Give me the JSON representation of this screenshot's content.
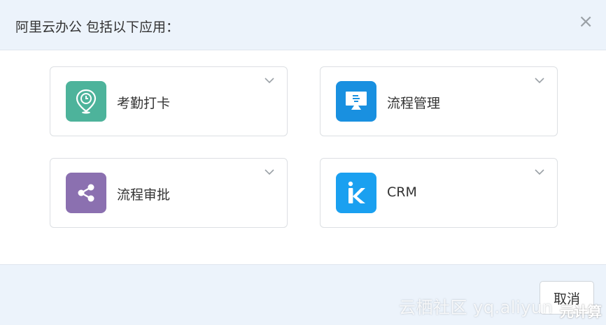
{
  "dialog": {
    "title": "阿里云办公 包括以下应用：",
    "close_symbol": "×",
    "cancel_label": "取消"
  },
  "apps": [
    {
      "label": "考勤打卡",
      "icon": "location-clock-icon",
      "color": "#4db39b"
    },
    {
      "label": "流程管理",
      "icon": "monitor-flow-icon",
      "color": "#1990e0"
    },
    {
      "label": "流程审批",
      "icon": "share-icon",
      "color": "#8b70b0"
    },
    {
      "label": "CRM",
      "icon": "k-logo-icon",
      "color": "#1aa0f0"
    }
  ],
  "watermark": {
    "text": "云栖社区 yq.aliyun",
    "text_strong": "元计算"
  }
}
